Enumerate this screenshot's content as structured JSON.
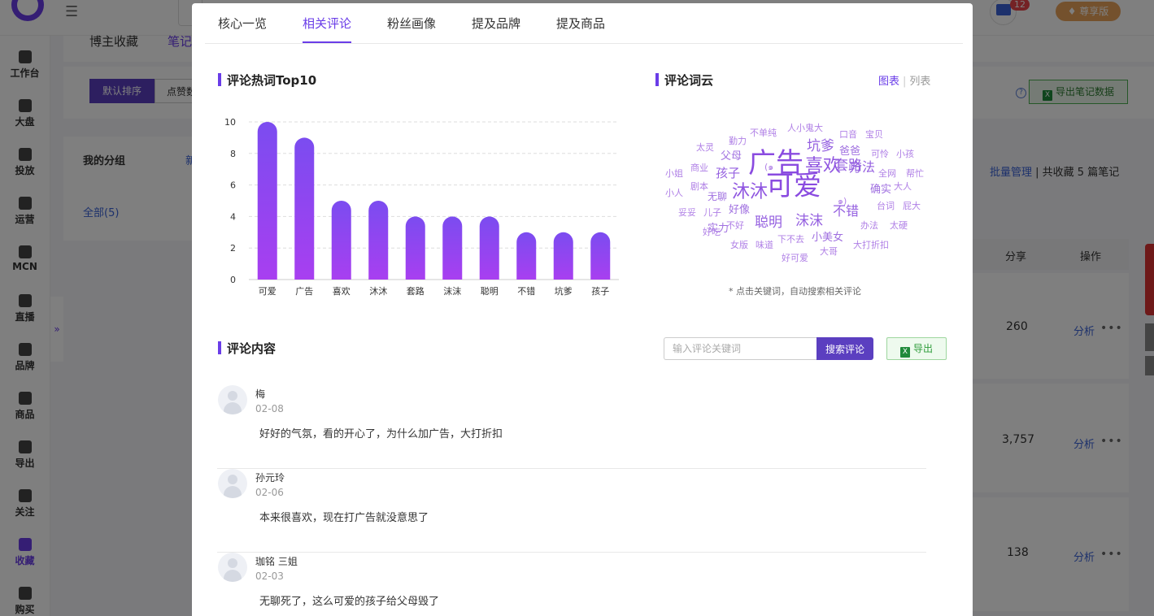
{
  "bg": {
    "tabs": [
      "博主收藏",
      "笔记"
    ],
    "vip_label": "尊享版",
    "msg_count": "12",
    "sidebar": [
      {
        "label": "工作台",
        "icon": "grid-icon"
      },
      {
        "label": "大盘",
        "icon": "pie-icon"
      },
      {
        "label": "投放",
        "icon": "folder-icon"
      },
      {
        "label": "运营",
        "icon": "trend-icon"
      },
      {
        "label": "MCN",
        "icon": "building-icon"
      },
      {
        "label": "直播",
        "icon": "video-icon"
      },
      {
        "label": "品牌",
        "icon": "tag-icon"
      },
      {
        "label": "商品",
        "icon": "bag-icon"
      },
      {
        "label": "导出",
        "icon": "upload-icon"
      },
      {
        "label": "关注",
        "icon": "eye-icon"
      },
      {
        "label": "收藏",
        "icon": "star-icon"
      },
      {
        "label": "购买",
        "icon": "cart-icon"
      }
    ],
    "sort_default": "默认排序",
    "sort_like": "点赞数",
    "export_notes": "导出笔记数据",
    "groups_title": "我的分组",
    "groups_new": "新",
    "groups_all": "全部(5)",
    "batch_manage": "批量管理",
    "collect_count": "共收藏 5 篇笔记",
    "col_share": "分享",
    "col_op": "操作",
    "rows": [
      {
        "share": "260",
        "analysis": "分析"
      },
      {
        "share": "3,757",
        "analysis": "分析"
      },
      {
        "share": "138",
        "analysis": "分析"
      }
    ]
  },
  "modal": {
    "tabs": [
      "核心一览",
      "相关评论",
      "粉丝画像",
      "提及品牌",
      "提及商品"
    ],
    "active_tab": "相关评论",
    "top10_title": "评论热词Top10",
    "cloud_title": "评论词云",
    "view_chart": "图表",
    "view_list": "列表",
    "cloud_hint": "* 点击关键词，自动搜索相关评论",
    "cloud_words": [
      {
        "w": "广告",
        "size": 34,
        "color": "#8a4be0"
      },
      {
        "w": "可爱",
        "size": 34,
        "color": "#8a4be0"
      },
      {
        "w": "喜欢",
        "size": 22,
        "color": "#8f55e0"
      },
      {
        "w": "沐沐",
        "size": 22,
        "color": "#8f55e0"
      },
      {
        "w": "坑爹",
        "size": 17,
        "color": "#9560e0"
      },
      {
        "w": "套路",
        "size": 17,
        "color": "#9560e0"
      },
      {
        "w": "方法",
        "size": 16,
        "color": "#9560e0"
      },
      {
        "w": "孩子",
        "size": 15,
        "color": "#9560e0"
      },
      {
        "w": "聪明",
        "size": 17,
        "color": "#9560e0"
      },
      {
        "w": "沫沫",
        "size": 17,
        "color": "#9560e0"
      },
      {
        "w": "不错",
        "size": 16,
        "color": "#9560e0"
      },
      {
        "w": "父母",
        "size": 13,
        "color": "#a070e0"
      },
      {
        "w": "爸爸",
        "size": 13,
        "color": "#a070e0"
      },
      {
        "w": "确实",
        "size": 13,
        "color": "#a070e0"
      },
      {
        "w": "好像",
        "size": 13,
        "color": "#a070e0"
      },
      {
        "w": "小美女",
        "size": 13,
        "color": "#a070e0"
      },
      {
        "w": "实力",
        "size": 13,
        "color": "#a070e0"
      },
      {
        "w": "无聊",
        "size": 12,
        "color": "#a070e0"
      },
      {
        "w": "口音",
        "size": 11,
        "color": "#b080e6"
      },
      {
        "w": "宝贝",
        "size": 11,
        "color": "#b080e6"
      },
      {
        "w": "人小鬼大",
        "size": 11,
        "color": "#b080e6"
      },
      {
        "w": "不单纯",
        "size": 11,
        "color": "#b080e6"
      },
      {
        "w": "勤力",
        "size": 11,
        "color": "#b080e6"
      },
      {
        "w": "太灵",
        "size": 11,
        "color": "#b080e6"
      },
      {
        "w": "可怜",
        "size": 11,
        "color": "#b080e6"
      },
      {
        "w": "小孩",
        "size": 11,
        "color": "#b080e6"
      },
      {
        "w": "商业",
        "size": 11,
        "color": "#b080e6"
      },
      {
        "w": "小姐",
        "size": 11,
        "color": "#b080e6"
      },
      {
        "w": "全网",
        "size": 11,
        "color": "#b080e6"
      },
      {
        "w": "帮忙",
        "size": 11,
        "color": "#b080e6"
      },
      {
        "w": "剧本",
        "size": 11,
        "color": "#b080e6"
      },
      {
        "w": "大人",
        "size": 11,
        "color": "#b080e6"
      },
      {
        "w": "小人",
        "size": 11,
        "color": "#b080e6"
      },
      {
        "w": "台词",
        "size": 11,
        "color": "#b080e6"
      },
      {
        "w": "屁大",
        "size": 11,
        "color": "#b080e6"
      },
      {
        "w": "妥妥",
        "size": 11,
        "color": "#b080e6"
      },
      {
        "w": "儿子",
        "size": 11,
        "color": "#b080e6"
      },
      {
        "w": "不好",
        "size": 11,
        "color": "#b080e6"
      },
      {
        "w": "办法",
        "size": 11,
        "color": "#b080e6"
      },
      {
        "w": "太硬",
        "size": 11,
        "color": "#b080e6"
      },
      {
        "w": "好吃",
        "size": 11,
        "color": "#b080e6"
      },
      {
        "w": "下不去",
        "size": 11,
        "color": "#b080e6"
      },
      {
        "w": "女版",
        "size": 11,
        "color": "#b080e6"
      },
      {
        "w": "味道",
        "size": 11,
        "color": "#b080e6"
      },
      {
        "w": "大哥",
        "size": 11,
        "color": "#b080e6"
      },
      {
        "w": "大打折扣",
        "size": 11,
        "color": "#b080e6"
      },
      {
        "w": "好可爱",
        "size": 11,
        "color": "#b080e6"
      },
      {
        "w": "(๑",
        "size": 11,
        "color": "#b080e6"
      },
      {
        "w": "๑)",
        "size": 11,
        "color": "#b080e6"
      }
    ],
    "comments_title": "评论内容",
    "search_placeholder": "输入评论关键词",
    "search_button": "搜索评论",
    "export_button": "导出",
    "excel_glyph": "X",
    "comments": [
      {
        "name": "梅",
        "date": "02-08",
        "text": "好好的气氛，看的开心了，为什么加广告，大打折扣"
      },
      {
        "name": "孙元玲",
        "date": "02-06",
        "text": "本来很喜欢，现在打广告就没意思了"
      },
      {
        "name": "珈铭 三姐",
        "date": "02-03",
        "text": "无聊死了，这么可爱的孩子给父母毁了"
      }
    ]
  },
  "chart_data": {
    "type": "bar",
    "title": "评论热词Top10",
    "categories": [
      "可爱",
      "广告",
      "喜欢",
      "沐沐",
      "套路",
      "沫沫",
      "聪明",
      "不错",
      "坑爹",
      "孩子"
    ],
    "values": [
      10,
      9,
      5,
      5,
      4,
      4,
      4,
      3,
      3,
      3
    ],
    "ylim": [
      0,
      10
    ],
    "yticks": [
      "0",
      "2",
      "4",
      "6",
      "8",
      "10"
    ],
    "grid": true,
    "bar_color_top": "#7b4cf0",
    "bar_color_bottom": "#a83ff0"
  }
}
